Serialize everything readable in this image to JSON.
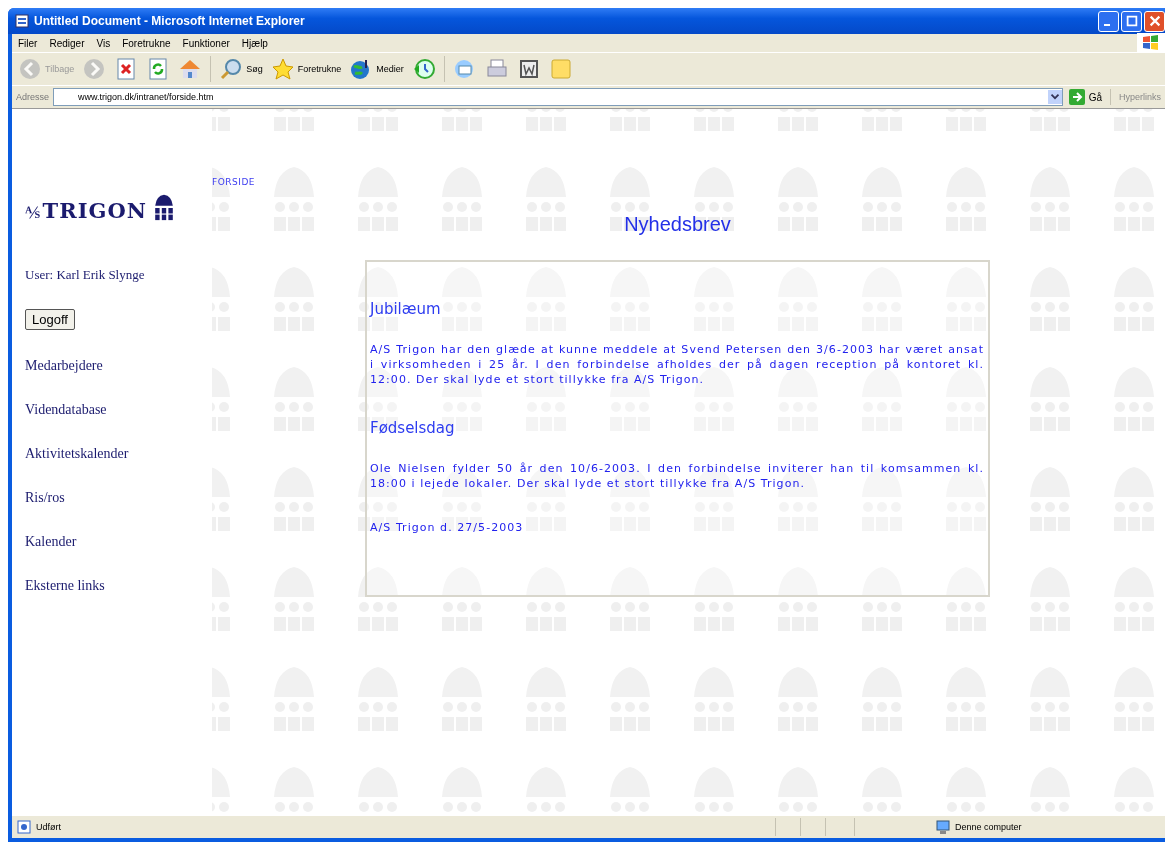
{
  "window": {
    "title": "Untitled Document - Microsoft Internet Explorer"
  },
  "menu": [
    "Filer",
    "Rediger",
    "Vis",
    "Foretrukne",
    "Funktioner",
    "Hjælp"
  ],
  "toolbar": [
    {
      "kind": "back",
      "label": "Tilbage",
      "disabled": true
    },
    {
      "kind": "forward",
      "disabled": true
    },
    {
      "kind": "stop",
      "disabled": false
    },
    {
      "kind": "refresh",
      "disabled": false
    },
    {
      "kind": "home",
      "disabled": false
    },
    {
      "kind": "search",
      "label": "Søg",
      "disabled": false
    },
    {
      "kind": "favorites",
      "label": "Foretrukne",
      "disabled": false
    },
    {
      "kind": "media",
      "label": "Medier",
      "disabled": false
    },
    {
      "kind": "history",
      "disabled": false
    },
    {
      "kind": "mail",
      "disabled": false
    },
    {
      "kind": "print",
      "disabled": false
    },
    {
      "kind": "edit",
      "disabled": false
    },
    {
      "kind": "note",
      "disabled": false
    }
  ],
  "address": {
    "label": "Adresse",
    "value": "www.trigon.dk/intranet/forside.htm",
    "go": "Gå",
    "links": "Hyperlinks"
  },
  "page": {
    "breadcrumb": "FORSIDE",
    "logo": {
      "mark": "⅍",
      "name": "TRIGON"
    },
    "user": "User: Karl Erik Slynge",
    "logoff": "Logoff",
    "nav": [
      "Medarbejdere",
      "Videndatabase",
      "Aktivitetskalender",
      "Ris/ros",
      "Kalender",
      "Eksterne links"
    ],
    "title": "Nyhedsbrev",
    "sections": [
      {
        "heading": "Jubilæum",
        "body": "A/S Trigon har den glæde at kunne meddele at Svend Petersen den 3/6-2003 har været ansat i virksomheden i 25 år. I den forbindelse afholdes der på dagen reception på kontoret kl. 12:00. Der skal lyde et stort tillykke fra A/S Trigon."
      },
      {
        "heading": "Fødselsdag",
        "body": "Ole Nielsen fylder 50 år den 10/6-2003. I den forbindelse inviterer han til komsammen kl. 18:00 i lejede lokaler. Der skal lyde et stort tillykke fra A/S Trigon."
      }
    ],
    "signature": "A/S Trigon d. 27/5-2003"
  },
  "status_bar": {
    "text": "Udført",
    "zone": "Denne computer"
  }
}
